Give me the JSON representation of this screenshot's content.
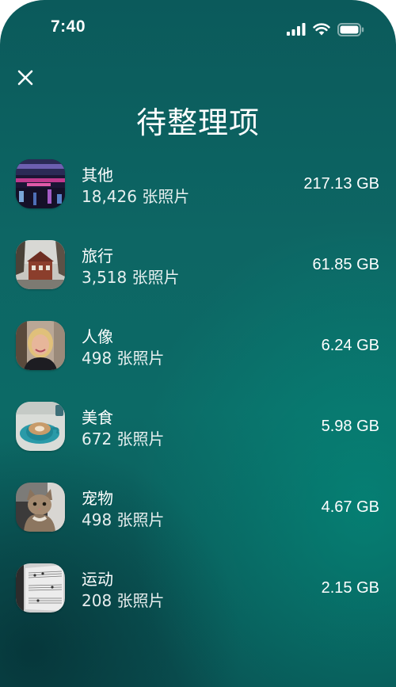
{
  "status_bar": {
    "time": "7:40"
  },
  "header": {
    "title": "待整理项",
    "close_icon": "close-icon"
  },
  "categories": [
    {
      "name": "其他",
      "count": "18,426 张照片",
      "size": "217.13 GB",
      "thumb": "abstract-lights"
    },
    {
      "name": "旅行",
      "count": "3,518 张照片",
      "size": "61.85 GB",
      "thumb": "travel-building"
    },
    {
      "name": "人像",
      "count": "498 张照片",
      "size": "6.24 GB",
      "thumb": "portrait-woman"
    },
    {
      "name": "美食",
      "count": "672 张照片",
      "size": "5.98 GB",
      "thumb": "coffee-cup"
    },
    {
      "name": "宠物",
      "count": "498 张照片",
      "size": "4.67 GB",
      "thumb": "cat"
    },
    {
      "name": "运动",
      "count": "208 张照片",
      "size": "2.15 GB",
      "thumb": "sheet-music"
    }
  ]
}
